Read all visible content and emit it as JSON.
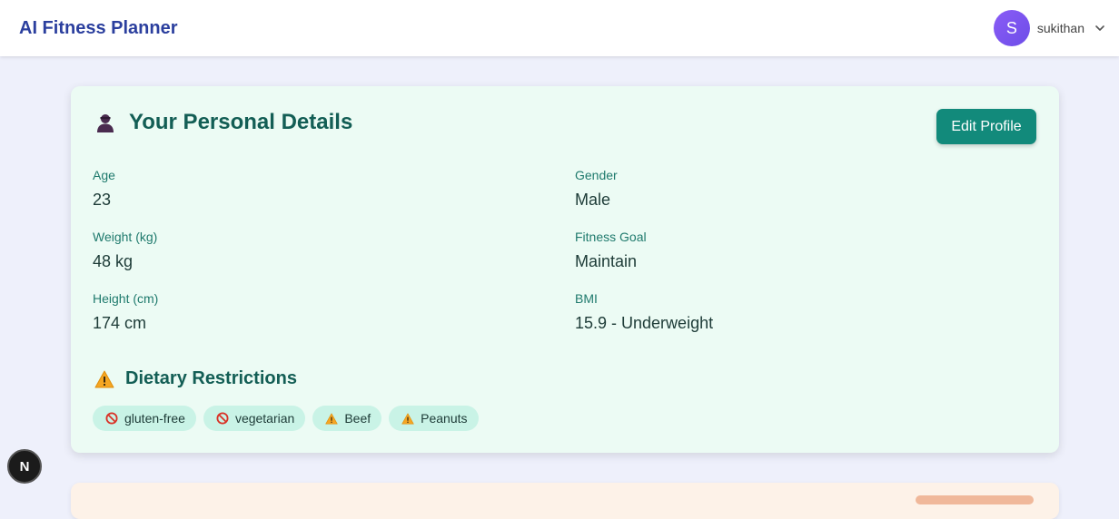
{
  "header": {
    "title": "AI Fitness Planner",
    "user": {
      "initial": "S",
      "name": "sukithan"
    }
  },
  "profile": {
    "title": "Your Personal Details",
    "edit_label": "Edit Profile",
    "fields": {
      "age": {
        "label": "Age",
        "value": "23"
      },
      "gender": {
        "label": "Gender",
        "value": "Male"
      },
      "weight": {
        "label": "Weight (kg)",
        "value": "48 kg"
      },
      "goal": {
        "label": "Fitness Goal",
        "value": "Maintain"
      },
      "height": {
        "label": "Height (cm)",
        "value": "174 cm"
      },
      "bmi": {
        "label": "BMI",
        "value": "15.9 - Underweight"
      }
    },
    "dietary": {
      "title": "Dietary Restrictions",
      "chips": [
        {
          "label": "gluten-free",
          "icon": "prohibited-icon"
        },
        {
          "label": "vegetarian",
          "icon": "prohibited-icon"
        },
        {
          "label": "Beef",
          "icon": "warning-icon"
        },
        {
          "label": "Peanuts",
          "icon": "warning-icon"
        }
      ]
    }
  },
  "badge": {
    "label": "N"
  },
  "colors": {
    "brand": "#2b3f9e",
    "accent": "#128a7b",
    "card_bg": "#ecfbf4",
    "chip_bg": "#c9f3e6"
  }
}
